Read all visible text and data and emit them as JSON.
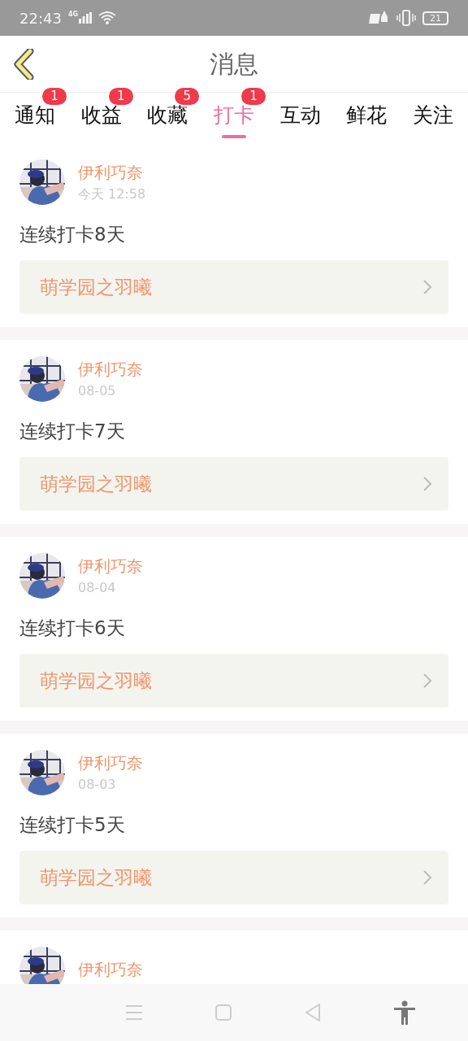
{
  "status_bar": {
    "time": "22:43",
    "network": "4G",
    "battery": "21"
  },
  "header": {
    "title": "消息"
  },
  "tabs": [
    {
      "label": "通知",
      "badge": "1",
      "selected": false
    },
    {
      "label": "收益",
      "badge": "1",
      "selected": false
    },
    {
      "label": "收藏",
      "badge": "5",
      "selected": false
    },
    {
      "label": "打卡",
      "badge": "1",
      "selected": true
    },
    {
      "label": "互动",
      "selected": false
    },
    {
      "label": "鲜花",
      "selected": false
    },
    {
      "label": "关注",
      "selected": false
    }
  ],
  "messages": [
    {
      "name": "伊利巧奈",
      "time": "今天 12:58",
      "text": "连续打卡8天",
      "link": "萌学园之羽曦"
    },
    {
      "name": "伊利巧奈",
      "time": "08-05",
      "text": "连续打卡7天",
      "link": "萌学园之羽曦"
    },
    {
      "name": "伊利巧奈",
      "time": "08-04",
      "text": "连续打卡6天",
      "link": "萌学园之羽曦"
    },
    {
      "name": "伊利巧奈",
      "time": "08-03",
      "text": "连续打卡5天",
      "link": "萌学园之羽曦"
    },
    {
      "name": "伊利巧奈"
    }
  ]
}
